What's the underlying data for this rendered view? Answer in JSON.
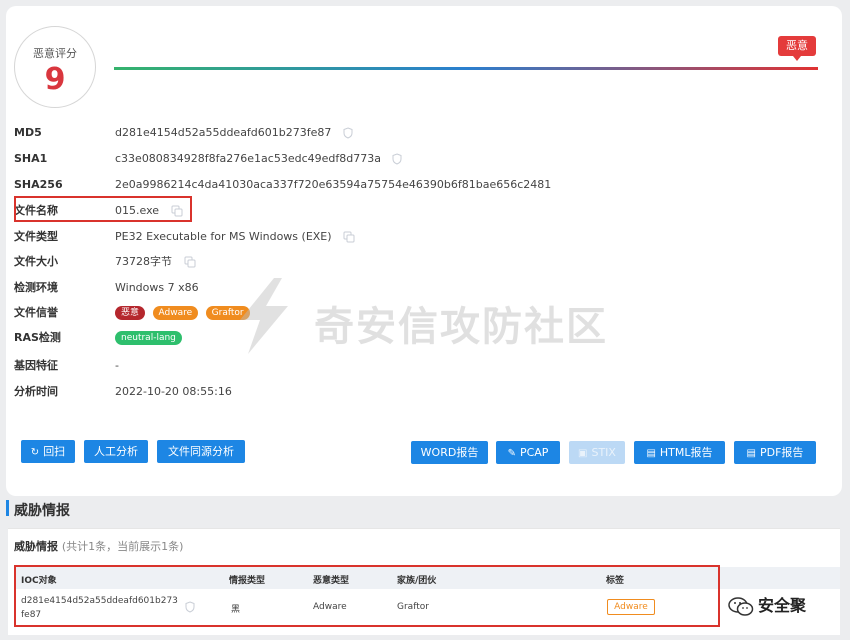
{
  "score": {
    "label": "恶意评分",
    "value": "9",
    "verdict": "恶意"
  },
  "info": {
    "md5": {
      "label": "MD5",
      "value": "d281e4154d52a55ddeafd601b273fe87"
    },
    "sha1": {
      "label": "SHA1",
      "value": "c33e080834928f8fa276e1ac53edc49edf8d773a"
    },
    "sha256": {
      "label": "SHA256",
      "value": "2e0a9986214c4da41030aca337f720e63594a75754e46390b6f81bae656c2481"
    },
    "filename": {
      "label": "文件名称",
      "value": "015.exe"
    },
    "filetype": {
      "label": "文件类型",
      "value": "PE32 Executable for MS Windows (EXE)"
    },
    "filesize": {
      "label": "文件大小",
      "value": "73728字节"
    },
    "env": {
      "label": "检测环境",
      "value": "Windows 7 x86"
    },
    "reputation": {
      "label": "文件信誉",
      "tags": [
        "恶意",
        "Adware",
        "Graftor"
      ]
    },
    "ras": {
      "label": "RAS检测",
      "tag": "neutral-lang"
    },
    "gene": {
      "label": "基因特征",
      "value": "-"
    },
    "time": {
      "label": "分析时间",
      "value": "2022-10-20 08:55:16"
    }
  },
  "watermark": "奇安信攻防社区",
  "actions": {
    "rescan": "回扫",
    "manual": "人工分析",
    "homology": "文件同源分析",
    "word": "WORD报告",
    "pcap": "PCAP",
    "stix": "STIX",
    "html": "HTML报告",
    "pdf": "PDF报告"
  },
  "threat": {
    "title": "威胁情报",
    "panel_title": "威胁情报",
    "count_text": "(共计1条，当前展示1条)",
    "columns": [
      "IOC对象",
      "情报类型",
      "恶意类型",
      "家族/团伙",
      "标签"
    ],
    "rows": [
      {
        "ioc_line1": "d281e4154d52a55ddeafd601b273",
        "ioc_line2": "fe87",
        "intel_type": "黑",
        "malicious_type": "Adware",
        "family": "Graftor",
        "tag": "Adware"
      }
    ]
  },
  "brand": "安全聚",
  "colors": {
    "accent": "#1d86e4",
    "danger": "#e43b3b",
    "orange": "#f08c1f",
    "green": "#2ebf6d"
  }
}
